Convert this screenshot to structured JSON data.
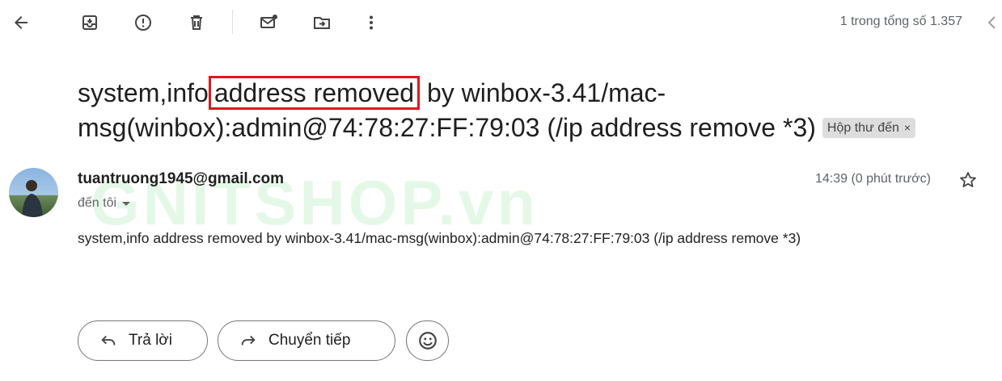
{
  "pagination": {
    "text": "1 trong tổng số 1.357"
  },
  "subject": {
    "before": "system,info",
    "highlight": "address removed",
    "after": " by winbox-3.41/mac-msg(winbox):admin@74:78:27:FF:79:03 (/ip address remove *3)",
    "label": "Hộp thư đến",
    "label_remove": "×"
  },
  "message": {
    "sender": "tuantruong1945@gmail.com",
    "recipient": "đến tôi",
    "time": "14:39 (0 phút trước)",
    "body": "system,info address removed by winbox-3.41/mac-msg(winbox):admin@74:78:27:FF:79:03 (/ip address remove *3)"
  },
  "watermark": "GNITSHOP.vn",
  "actions": {
    "reply": "Trả lời",
    "forward": "Chuyển tiếp"
  },
  "colors": {
    "highlight_border": "#e0161f",
    "label_bg": "#dddddd"
  }
}
